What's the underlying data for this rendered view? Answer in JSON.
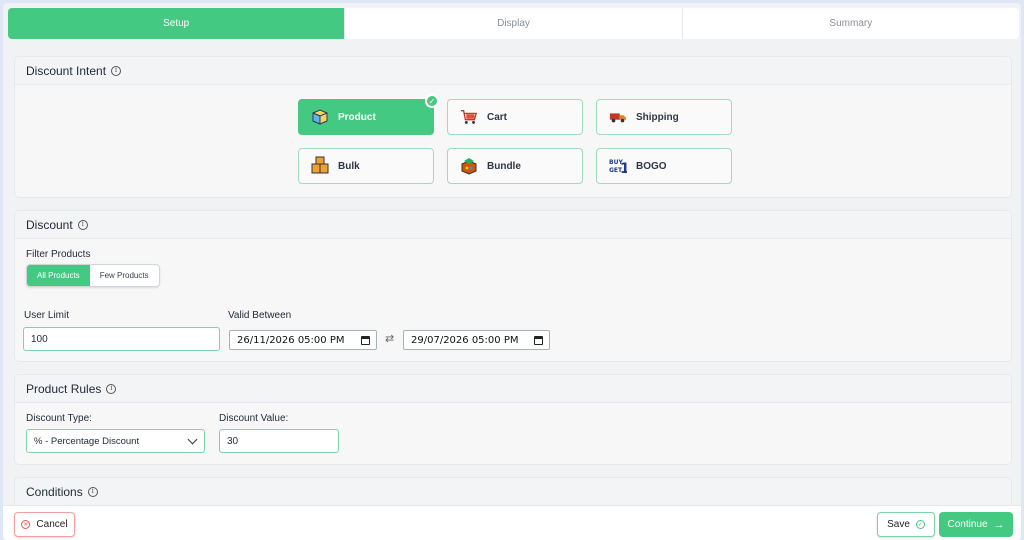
{
  "tabs": [
    {
      "label": "Setup",
      "active": true
    },
    {
      "label": "Display",
      "active": false
    },
    {
      "label": "Summary",
      "active": false
    }
  ],
  "intent": {
    "title": "Discount Intent",
    "options": [
      {
        "label": "Product",
        "icon": "package-icon",
        "selected": true
      },
      {
        "label": "Cart",
        "icon": "shopping-cart-icon",
        "selected": false
      },
      {
        "label": "Shipping",
        "icon": "truck-icon",
        "selected": false
      },
      {
        "label": "Bulk",
        "icon": "boxes-icon",
        "selected": false
      },
      {
        "label": "Bundle",
        "icon": "bundle-icon",
        "selected": false
      },
      {
        "label": "BOGO",
        "icon": "buy-get-icon",
        "selected": false
      }
    ]
  },
  "discount": {
    "title": "Discount",
    "filter_label": "Filter Products",
    "filter_options": [
      "All Products",
      "Few Products"
    ],
    "user_limit_label": "User Limit",
    "user_limit_value": "100",
    "valid_between_label": "Valid Between",
    "valid_from": "26/11/2026 05:00 PM",
    "valid_to": "29/07/2026 05:00 PM"
  },
  "rules": {
    "title": "Product Rules",
    "type_label": "Discount Type:",
    "type_value": "% - Percentage Discount",
    "value_label": "Discount Value:",
    "value_value": "30"
  },
  "conditions": {
    "title": "Conditions"
  },
  "footer": {
    "cancel": "Cancel",
    "save": "Save",
    "continue": "Continue"
  },
  "colors": {
    "accent": "#44c983",
    "cancel_border": "#f0a0a0"
  }
}
